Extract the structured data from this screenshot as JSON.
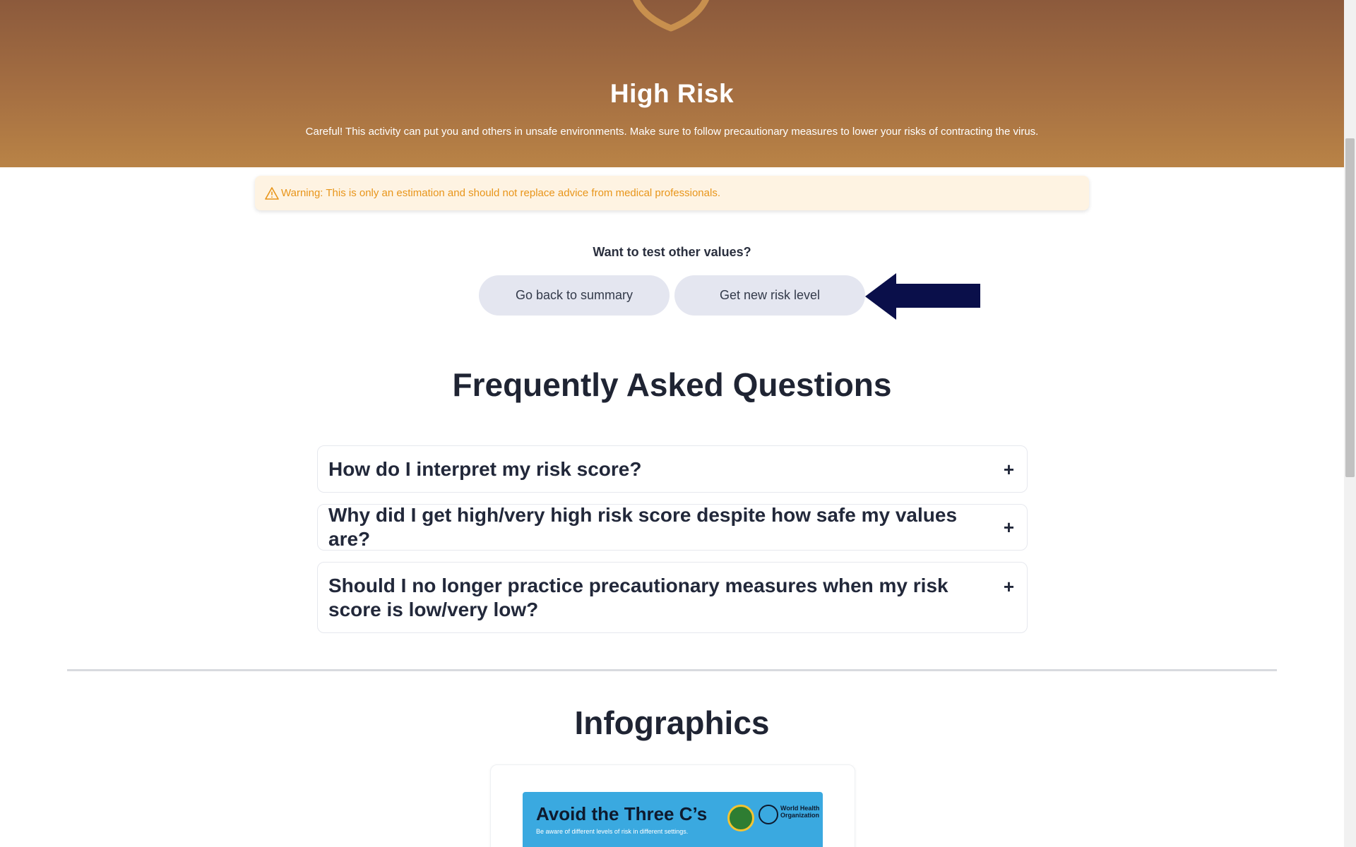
{
  "hero": {
    "title": "High Risk",
    "description": "Careful! This activity can put you and others in unsafe environments. Make sure to follow precautionary measures to lower your risks of contracting the virus.",
    "emblem_icon": "shield-virus-icon",
    "background_color": "#a56f42"
  },
  "warning": {
    "icon": "warning-triangle-icon",
    "text": "Warning: This is only an estimation and should not replace advice from medical professionals.",
    "color": "#e8951a"
  },
  "actions": {
    "prompt": "Want to test other values?",
    "summary_label": "Go back to summary",
    "new_risk_label": "Get new risk level",
    "pointer_icon": "arrow-left-icon",
    "pointer_color": "#0a0f4a"
  },
  "faq": {
    "title": "Frequently Asked Questions",
    "items": [
      {
        "question": "How do I interpret my risk score?",
        "toggle": "+"
      },
      {
        "question": "Why did I get high/very high risk score despite how safe my values are?",
        "toggle": "+"
      },
      {
        "question": "Should I no longer practice precautionary measures when my risk score is low/very low?",
        "toggle": "+"
      }
    ]
  },
  "infographics": {
    "title": "Infographics",
    "poster": {
      "title": "Avoid the Three C’s",
      "subtitle": "Be aware of different levels of risk in different settings.",
      "org": "World Health Organization"
    }
  }
}
